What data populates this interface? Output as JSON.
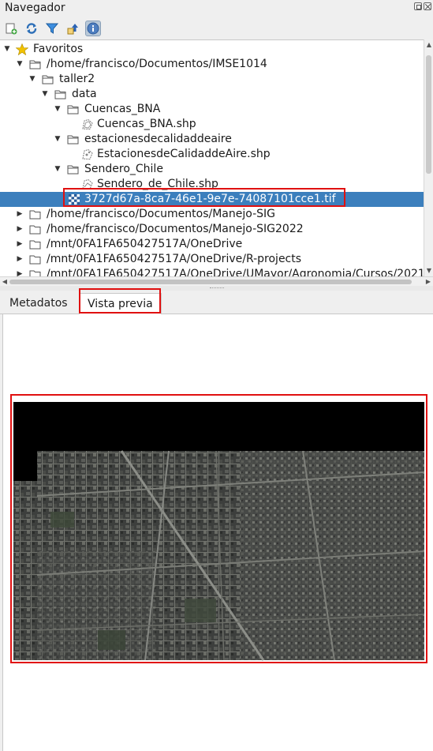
{
  "panel": {
    "title": "Navegador"
  },
  "toolbar": {
    "icons": [
      "add-layer-icon",
      "refresh-icon",
      "filter-icon",
      "collapse-all-icon",
      "info-icon"
    ]
  },
  "tree": {
    "favorites": "Favoritos",
    "path_imse": "/home/francisco/Documentos/IMSE1014",
    "taller2": "taller2",
    "data": "data",
    "cuencas_folder": "Cuencas_BNA",
    "cuencas_shp": "Cuencas_BNA.shp",
    "estaciones_folder": "estacionesdecalidaddeaire",
    "estaciones_shp": "EstacionesdeCalidaddeAire.shp",
    "sendero_folder": "Sendero_Chile",
    "sendero_shp": "Sendero_de_Chile.shp",
    "tif_file": "3727d67a-8ca7-46e1-9e7e-74087101cce1.tif",
    "path_manejo": "/home/francisco/Documentos/Manejo-SIG",
    "path_manejo2022": "/home/francisco/Documentos/Manejo-SIG2022",
    "path_onedrive": "/mnt/0FA1FA650427517A/OneDrive",
    "path_rprojects": "/mnt/0FA1FA650427517A/OneDrive/R-projects",
    "path_umayor": "/mnt/0FA1FA650427517A/OneDrive/UMayor/Agronomia/Cursos/2021"
  },
  "tabs": {
    "metadata": "Metadatos",
    "preview": "Vista previa"
  },
  "colors": {
    "selection": "#3c7fbd",
    "highlight": "#e01010",
    "folder_star": "#f2c200"
  }
}
